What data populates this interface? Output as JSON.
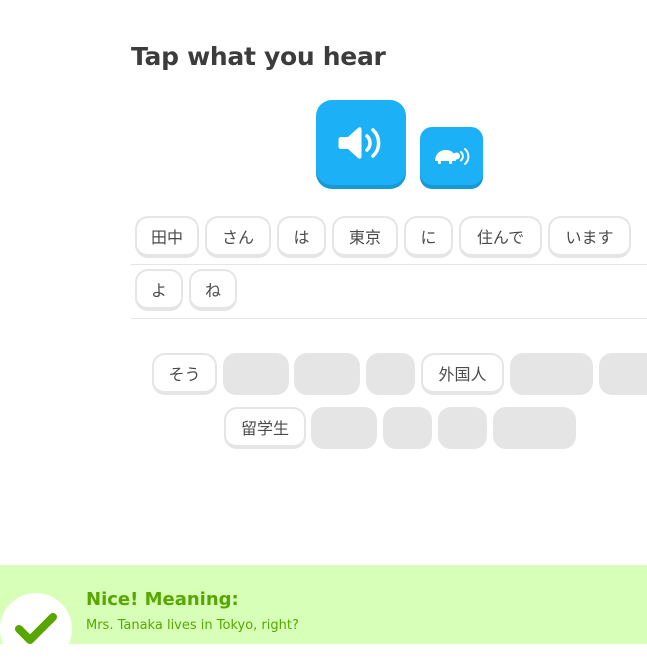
{
  "prompt": {
    "title": "Tap what you hear"
  },
  "audio": {
    "play_icon": "speaker-icon",
    "slow_icon": "turtle-speaker-icon"
  },
  "answer": {
    "rows": [
      [
        "田中",
        "さん",
        "は",
        "東京",
        "に",
        "住んで",
        "います"
      ],
      [
        "よ",
        "ね"
      ]
    ]
  },
  "word_bank": {
    "row1": [
      "そう",
      "",
      "",
      "",
      "外国人",
      "",
      ""
    ],
    "row2": [
      "留学生",
      "",
      "",
      "",
      ""
    ]
  },
  "feedback": {
    "status": "correct",
    "title": "Nice! Meaning:",
    "meaning": "Mrs. Tanaka lives in Tokyo, right?",
    "icon": "checkmark-icon"
  },
  "colors": {
    "accent_blue": "#1cb0f6",
    "success_green": "#58a700",
    "footer_bg": "#d7ffb8",
    "empty_slot": "#e5e5e5"
  }
}
